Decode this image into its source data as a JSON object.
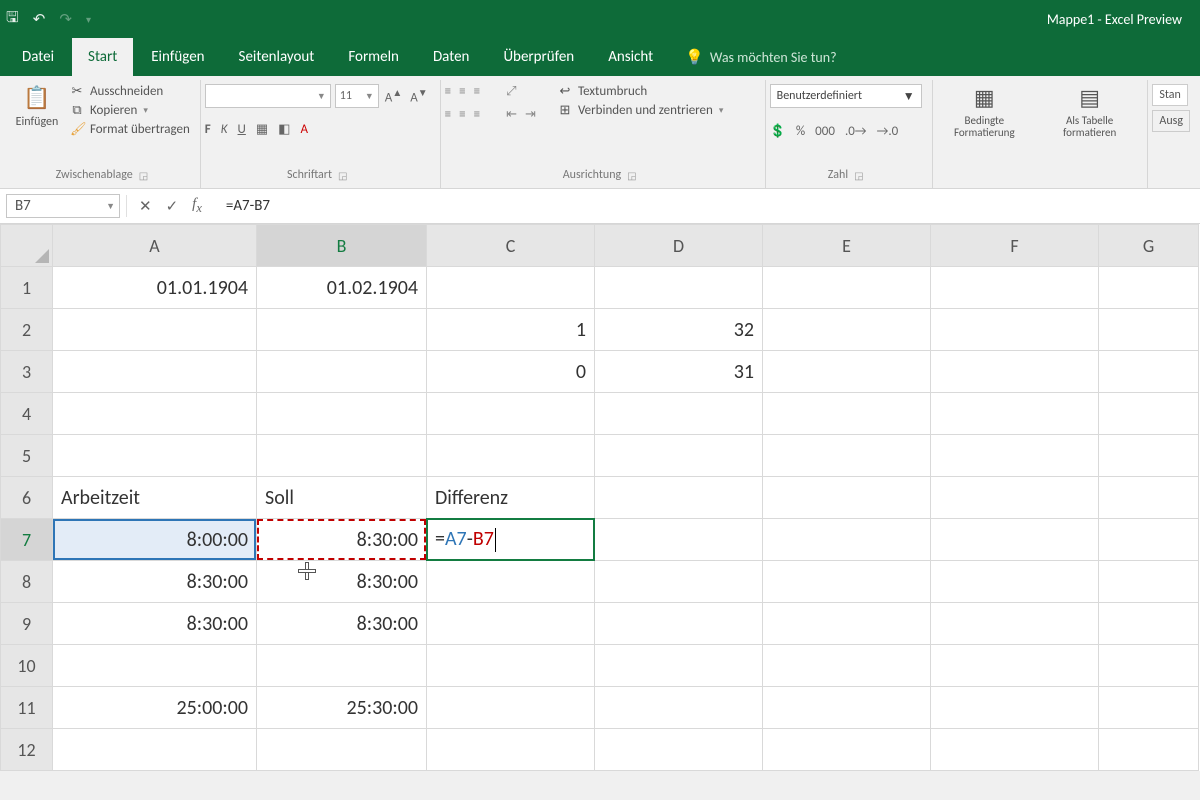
{
  "title": "Mappe1  -  Excel Preview",
  "tabs": {
    "file": "Datei",
    "active": "Start",
    "others": [
      "Einfügen",
      "Seitenlayout",
      "Formeln",
      "Daten",
      "Überprüfen",
      "Ansicht"
    ],
    "tellme": "Was möchten Sie tun?"
  },
  "ribbon": {
    "clipboard": {
      "paste": "Einfügen",
      "cut": "Ausschneiden",
      "copy": "Kopieren",
      "painter": "Format übertragen",
      "group_label": "Zwischenablage"
    },
    "font": {
      "name": "",
      "size": "11",
      "group_label": "Schriftart",
      "bold": "F",
      "italic": "K",
      "underline": "U"
    },
    "align": {
      "wrap": "Textumbruch",
      "merge": "Verbinden und zentrieren",
      "group_label": "Ausrichtung"
    },
    "number": {
      "format": "Benutzerdefiniert",
      "group_label": "Zahl"
    },
    "styles": {
      "cond": "Bedingte Formatierung",
      "tbl": "Als Tabelle formatieren"
    },
    "cells": {
      "std": "Stan",
      "out": "Ausg"
    }
  },
  "formula_bar": {
    "name_box": "B7",
    "formula": "=A7-B7"
  },
  "columns": [
    "A",
    "B",
    "C",
    "D",
    "E",
    "F",
    "G"
  ],
  "rows": [
    "1",
    "2",
    "3",
    "4",
    "5",
    "6",
    "7",
    "8",
    "9",
    "10",
    "11",
    "12"
  ],
  "cells": {
    "A1": "01.01.1904",
    "B1": "01.02.1904",
    "C2": "1",
    "D2": "32",
    "C3": "0",
    "D3": "31",
    "A6": "Arbeitzeit",
    "B6": "Soll",
    "C6": "Differenz",
    "A7": "8:00:00",
    "B7": "8:30:00",
    "C7_eq": "=",
    "C7_a": "A7",
    "C7_m": "-",
    "C7_b": "B7",
    "A8": "8:30:00",
    "B8": "8:30:00",
    "A9": "8:30:00",
    "B9": "8:30:00",
    "A11": "25:00:00",
    "B11": "25:30:00"
  },
  "chart_data": {
    "type": "table",
    "headers": [
      "Arbeitzeit",
      "Soll",
      "Differenz"
    ],
    "rows": [
      [
        "8:00:00",
        "8:30:00",
        "=A7-B7"
      ],
      [
        "8:30:00",
        "8:30:00",
        ""
      ],
      [
        "8:30:00",
        "8:30:00",
        ""
      ],
      [
        "",
        "",
        ""
      ],
      [
        "25:00:00",
        "25:30:00",
        ""
      ]
    ],
    "aux_dates": [
      "01.01.1904",
      "01.02.1904"
    ],
    "aux_values": {
      "C2": 1,
      "D2": 32,
      "C3": 0,
      "D3": 31
    }
  }
}
